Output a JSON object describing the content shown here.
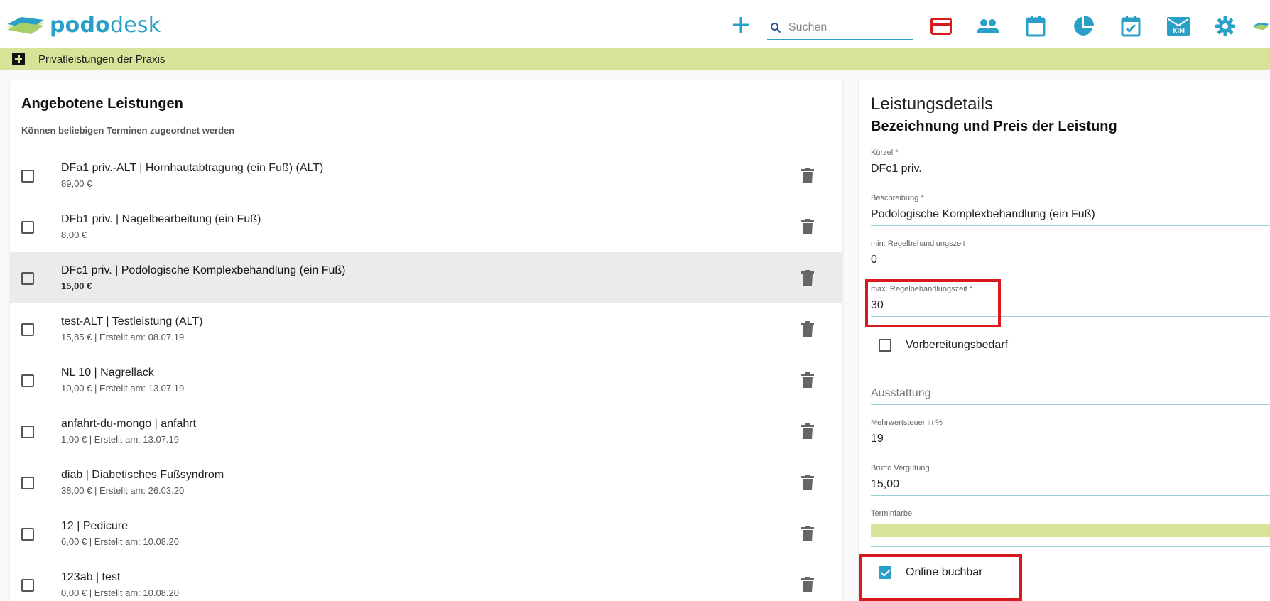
{
  "app": {
    "logo_bold": "podo",
    "logo_rest": "desk",
    "brand_color": "#2aa0c8",
    "accent_green": "#d6e49a",
    "highlight_red": "#d9181f"
  },
  "header": {
    "add_icon": "plus-icon",
    "search_placeholder": "Suchen",
    "icons": [
      "credit-card-icon",
      "people-icon",
      "calendar-icon",
      "pie-chart-icon",
      "calendar-check-icon",
      "kim-mail-icon",
      "gear-icon",
      "logo-icon"
    ],
    "kim_label": "KIM"
  },
  "subbar": {
    "title": "Privatleistungen der Praxis"
  },
  "left": {
    "title": "Angebotene Leistungen",
    "subtitle": "Können beliebigen Terminen zugeordnet werden",
    "items": [
      {
        "title": "DFa1 priv.-ALT | Hornhautabtragung (ein Fuß) (ALT)",
        "meta": "89,00 €"
      },
      {
        "title": "DFb1 priv. | Nagelbearbeitung (ein Fuß)",
        "meta": "8,00 €"
      },
      {
        "title": "DFc1 priv. | Podologische Komplexbehandlung (ein Fuß)",
        "meta": "15,00 €"
      },
      {
        "title": "test-ALT | Testleistung (ALT)",
        "meta": "15,85 € | Erstellt am: 08.07.19"
      },
      {
        "title": "NL 10 | Nagrellack",
        "meta": "10,00 € | Erstellt am: 13.07.19"
      },
      {
        "title": "anfahrt-du-mongo | anfahrt",
        "meta": "1,00 € | Erstellt am: 13.07.19"
      },
      {
        "title": "diab | Diabetisches Fußsyndrom",
        "meta": "38,00 € | Erstellt am: 26.03.20"
      },
      {
        "title": "12 | Pedicure",
        "meta": "6,00 € | Erstellt am: 10.08.20"
      },
      {
        "title": "123ab | test",
        "meta": "0,00 € | Erstellt am: 10.08.20"
      }
    ]
  },
  "right": {
    "title": "Leistungsdetails",
    "subtitle": "Bezeichnung und Preis der Leistung",
    "fields": {
      "kuerzel": {
        "label": "Kürzel *",
        "value": "DFc1 priv."
      },
      "beschreibung": {
        "label": "Beschreibung *",
        "value": "Podologische Komplexbehandlung (ein Fuß)"
      },
      "min_zeit": {
        "label": "min. Regelbehandlungszeit",
        "value": "0"
      },
      "max_zeit": {
        "label": "max. Regelbehandlungszeit *",
        "value": "30"
      },
      "ausstattung": {
        "placeholder": "Ausstattung"
      },
      "mwst": {
        "label": "Mehrwertsteuer in %",
        "value": "19"
      },
      "brutto": {
        "label": "Brutto Vergütung",
        "value": "15,00"
      },
      "terminfarbe": {
        "label": "Terminfarbe"
      }
    },
    "vorbereitung_label": "Vorbereitungsbedarf",
    "online_label": "Online buchbar"
  }
}
